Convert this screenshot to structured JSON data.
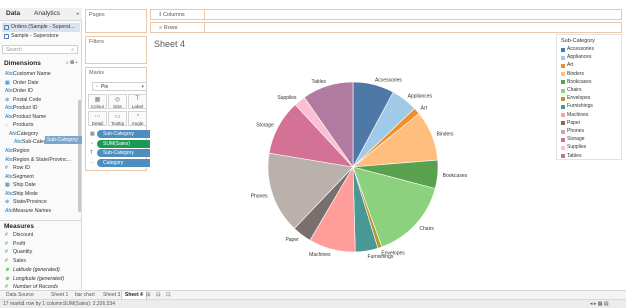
{
  "left_pane": {
    "tabs": [
      "Data",
      "Analytics"
    ],
    "datasources": [
      "Orders (Sample - Superst...",
      "Sample - Superstore"
    ],
    "search_placeholder": "Search",
    "dimensions_title": "Dimensions",
    "dimensions": [
      {
        "icon": "Abc",
        "label": "Customer Name"
      },
      {
        "icon": "▦",
        "label": "Order Date"
      },
      {
        "icon": "Abc",
        "label": "Order ID"
      },
      {
        "icon": "⊕",
        "label": "Postal Code"
      },
      {
        "icon": "Abc",
        "label": "Product ID"
      },
      {
        "icon": "Abc",
        "label": "Product Name"
      },
      {
        "icon": "∴",
        "label": "Products"
      },
      {
        "icon": "Abc",
        "label": "Category"
      },
      {
        "icon": "Abc",
        "label": "Sub-Category"
      },
      {
        "icon": "Abc",
        "label": "Region"
      },
      {
        "icon": "Abc",
        "label": "Region & State/Provinc..."
      },
      {
        "icon": "#",
        "label": "Row ID"
      },
      {
        "icon": "Abc",
        "label": "Segment"
      },
      {
        "icon": "▦",
        "label": "Ship Date"
      },
      {
        "icon": "Abc",
        "label": "Ship Mode"
      },
      {
        "icon": "⊕",
        "label": "State/Province"
      },
      {
        "icon": "Abc",
        "label": "Measure Names"
      }
    ],
    "drag_tip": "Sub-Category",
    "measures_title": "Measures",
    "measures": [
      {
        "icon": "#",
        "label": "Discount"
      },
      {
        "icon": "#",
        "label": "Profit"
      },
      {
        "icon": "#",
        "label": "Quantity"
      },
      {
        "icon": "#",
        "label": "Sales"
      },
      {
        "icon": "⊕",
        "label": "Latitude (generated)"
      },
      {
        "icon": "⊕",
        "label": "Longitude (generated)"
      },
      {
        "icon": "#",
        "label": "Number of Records"
      }
    ]
  },
  "pages_card": {
    "title": "Pages"
  },
  "filters_card": {
    "title": "Filters"
  },
  "marks_card": {
    "title": "Marks",
    "mark_type": "Pie",
    "buttons": [
      {
        "glyph": "▦",
        "label": "Colour"
      },
      {
        "glyph": "◎",
        "label": "Size"
      },
      {
        "glyph": "T",
        "label": "Label"
      },
      {
        "glyph": "⋯",
        "label": "Detail"
      },
      {
        "glyph": "▭",
        "label": "Tooltip"
      },
      {
        "glyph": "◔",
        "label": "Angle"
      }
    ],
    "pills": [
      {
        "icon": "▦",
        "label": "Sub-Category",
        "color": "blue"
      },
      {
        "icon": "◔",
        "label": "SUM(Sales)",
        "color": "green"
      },
      {
        "icon": "T",
        "label": "Sub-Category",
        "color": "blue"
      },
      {
        "icon": "⋯",
        "label": "Category",
        "color": "blue"
      }
    ]
  },
  "shelves": {
    "columns": "Columns",
    "rows": "Rows"
  },
  "sheet": {
    "title": "Sheet 4"
  },
  "chart_data": {
    "type": "pie",
    "title": "Sheet 4",
    "measure": "SUM(Sales)",
    "color_field": "Sub-Category",
    "slices": [
      {
        "label": "Accessories",
        "value": 167380,
        "color": "#4e79a7"
      },
      {
        "label": "Appliances",
        "value": 107532,
        "color": "#a0cbe8"
      },
      {
        "label": "Art",
        "value": 27119,
        "color": "#f28e2b"
      },
      {
        "label": "Binders",
        "value": 203413,
        "color": "#ffbe7d"
      },
      {
        "label": "Bookcases",
        "value": 114880,
        "color": "#59a14f"
      },
      {
        "label": "Chairs",
        "value": 328449,
        "color": "#8cd17d"
      },
      {
        "label": "Envelopes",
        "value": 16476,
        "color": "#b6992d"
      },
      {
        "label": "Furnishings",
        "value": 91705,
        "color": "#499894"
      },
      {
        "label": "Machines",
        "value": 189239,
        "color": "#ff9d9a"
      },
      {
        "label": "Paper",
        "value": 78479,
        "color": "#79706e"
      },
      {
        "label": "Phones",
        "value": 330007,
        "color": "#bab0ac"
      },
      {
        "label": "Storage",
        "value": 223844,
        "color": "#d37295"
      },
      {
        "label": "Supplies",
        "value": 46674,
        "color": "#fabfd2"
      },
      {
        "label": "Tables",
        "value": 206966,
        "color": "#b07aa1"
      }
    ]
  },
  "legend": {
    "title": "Sub-Category"
  },
  "sheet_tabs": [
    "Data Source",
    "Sheet 1",
    "bar chart",
    "Sheet 3",
    "Sheet 4"
  ],
  "status": {
    "marks": "17 marks",
    "rows_cols": "1 row by 1 column",
    "sum": "SUM(Sales): 2,326,534"
  }
}
